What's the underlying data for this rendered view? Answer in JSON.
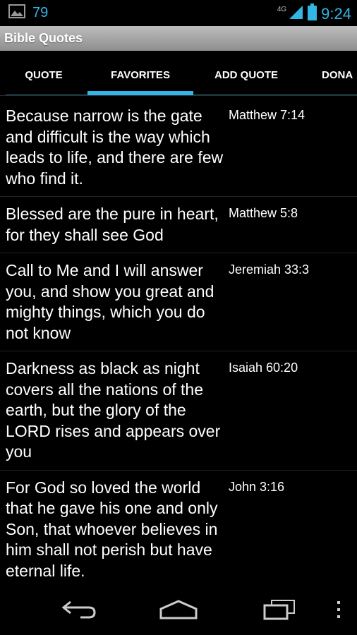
{
  "status_bar": {
    "notification_count": "79",
    "network": "4G",
    "time": "9:24"
  },
  "action_bar": {
    "title": "Bible Quotes"
  },
  "tabs": [
    {
      "label": "QUOTE",
      "selected": false
    },
    {
      "label": "FAVORITES",
      "selected": true
    },
    {
      "label": "ADD QUOTE",
      "selected": false
    },
    {
      "label": "DONA",
      "selected": false
    }
  ],
  "quotes": [
    {
      "text": "Because narrow is the gate and difficult is the way which leads to life, and there are few who find it.",
      "reference": "Matthew 7:14"
    },
    {
      "text": "Blessed are the pure in heart, for they shall see God",
      "reference": "Matthew 5:8"
    },
    {
      "text": "Call to Me and I will answer you, and show you great and mighty things, which you do not know",
      "reference": "Jeremiah 33:3"
    },
    {
      "text": "Darkness as black as night covers all the nations of the earth, but the glory of the LORD rises and appears over you",
      "reference": "Isaiah 60:20"
    },
    {
      "text": "For God so loved the world that he gave his one and only Son, that whoever believes in him shall not perish but have eternal life.",
      "reference": "John 3:16"
    }
  ],
  "colors": {
    "accent": "#33b5e5",
    "background": "#000000"
  },
  "icons": {
    "notification": "image-icon",
    "signal": "signal-icon",
    "battery": "battery-icon",
    "back": "back-icon",
    "home": "home-icon",
    "recents": "recents-icon",
    "menu": "overflow-menu-icon"
  }
}
